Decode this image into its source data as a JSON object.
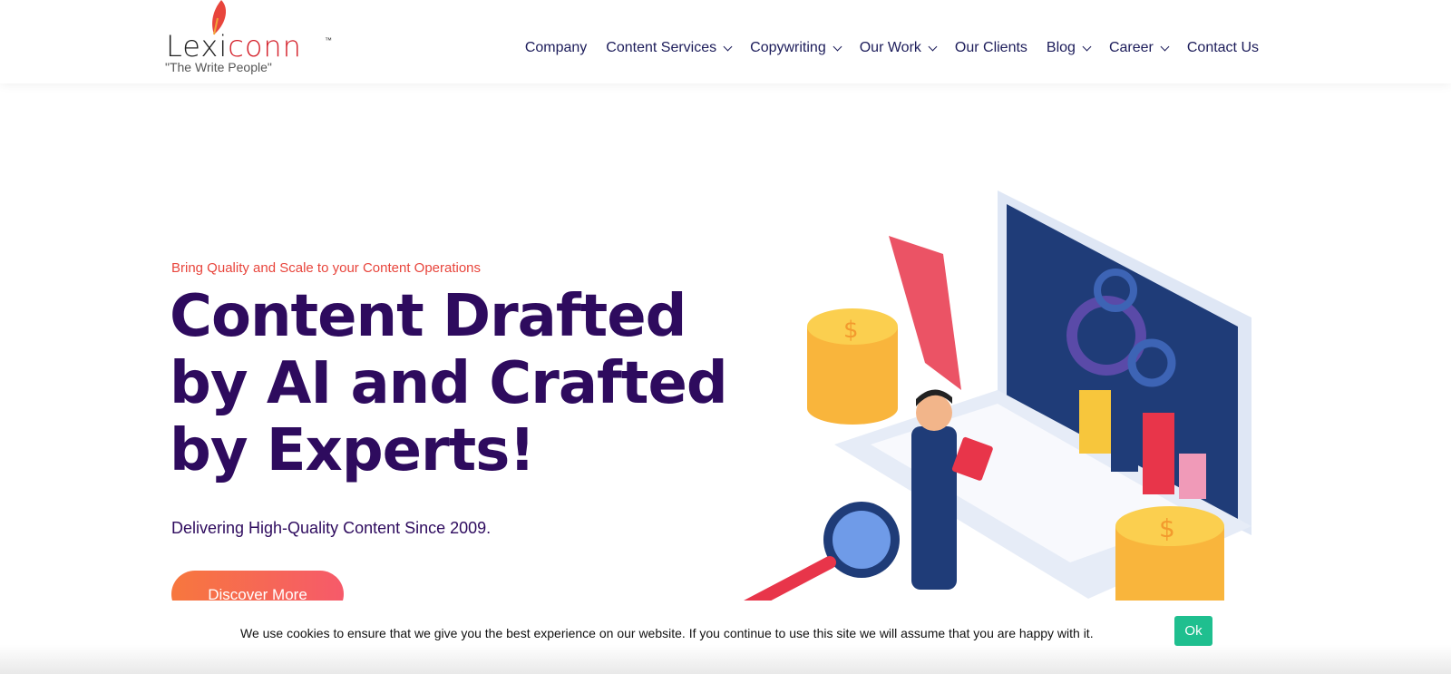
{
  "brand": {
    "name_part1": "Lexi",
    "name_part2": "conn",
    "tm": "™",
    "tagline": "\"The Write People\""
  },
  "nav": [
    {
      "label": "Company",
      "dropdown": false
    },
    {
      "label": "Content Services",
      "dropdown": true
    },
    {
      "label": "Copywriting",
      "dropdown": true
    },
    {
      "label": "Our Work",
      "dropdown": true
    },
    {
      "label": "Our Clients",
      "dropdown": false
    },
    {
      "label": "Blog",
      "dropdown": true
    },
    {
      "label": "Career",
      "dropdown": true
    },
    {
      "label": "Contact Us",
      "dropdown": false
    }
  ],
  "hero": {
    "eyebrow": "Bring Quality and Scale to your Content Operations",
    "title_line1": "Content Drafted",
    "title_line2": "by AI and Crafted",
    "title_line3": "by Experts!",
    "subtitle": "Delivering High-Quality Content Since 2009.",
    "cta": "Discover More"
  },
  "cookie": {
    "message": "We use cookies to ensure that we give you the best experience on our website. If you continue to use this site we will assume that you are happy with it.",
    "ok": "Ok"
  },
  "colors": {
    "accent": "#e8453c",
    "title": "#2e0b5e",
    "ok": "#1fbf8f"
  }
}
